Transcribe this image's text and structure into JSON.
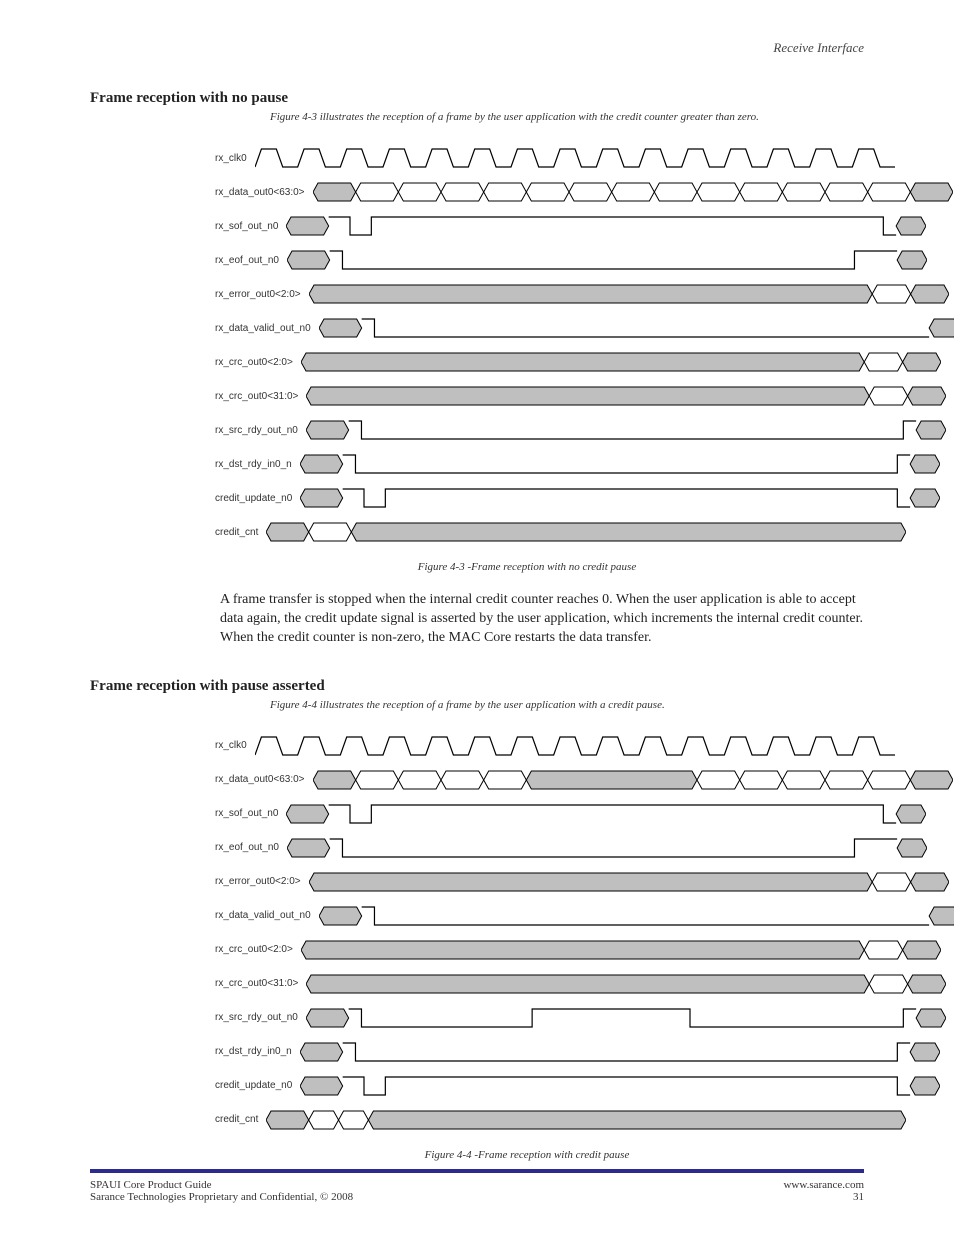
{
  "runhead": "Receive Interface",
  "section1_title": "Frame reception with no pause",
  "section2_title": "Frame reception with pause asserted",
  "signals": [
    "rx_clk0",
    "rx_data_out0<63:0>",
    "rx_sof_out_n0",
    "rx_eof_out_n0",
    "rx_error_out0<2:0>",
    "rx_data_valid_out_n0",
    "rx_crc_out0<2:0>",
    "rx_crc_out0<31:0>",
    "rx_src_rdy_out_n0",
    "rx_dst_rdy_in0_n",
    "credit_update_n0",
    "credit_cnt"
  ],
  "paragraph": "A frame transfer is stopped when the internal credit counter reaches 0. When the user application is able to accept data again, the credit update signal is asserted by the user application, which increments the internal credit counter. When the credit counter is non-zero, the MAC Core restarts the data transfer.",
  "fig1_caption": "Figure 4-3 illustrates the reception of a frame by the user application with the credit counter greater than zero.",
  "fig1_label": "Figure 4-3 -Frame reception with no credit pause",
  "fig2_caption": "Figure 4-4 illustrates the reception of a frame by the user application with a credit pause.",
  "fig2_label": "Figure 4-4 -Frame reception with credit pause",
  "footer_left_line1": "SPAUI Core Product Guide",
  "footer_left_line2": "Sarance Technologies Proprietary and Confidential, © 2008",
  "footer_right_line1": "www.sarance.com",
  "footer_right_line2": "31",
  "chart_data": [
    {
      "type": "timing",
      "title": "Frame reception with no pause",
      "clock_cycles": 15,
      "signals": {
        "rx_clk0": "clock 15 cycles",
        "rx_data_out0<63:0>": "bus, new value every cycle",
        "rx_sof_out_n0": "high, low pulse at cycle 1, high until cycle 14 then low",
        "rx_eof_out_n0": "high, low from cycle 1 to 13, rising at cycle 13",
        "rx_error_out0<2:0>": "bus, hold then change at cycle 13 and 14",
        "rx_data_valid_out_n0": "high then low from cycle 1, low at end",
        "rx_crc_out0<2:0>": "bus, change at cycle 13 and 14",
        "rx_crc_out0<31:0>": "bus, change at cycle 13 and 14",
        "rx_src_rdy_out_n0": "high, low from cycle 1 to 13, then high",
        "rx_dst_rdy_in0_n": "high, low from cycle 1 to 13, then high",
        "credit_update_n0": "high, low pulse at cycle 1, high, low at end",
        "credit_cnt": "bus, change at cycle 1 then hold"
      }
    },
    {
      "type": "timing",
      "title": "Frame reception with pause asserted",
      "clock_cycles": 15,
      "signals": {
        "rx_clk0": "clock 15 cycles",
        "rx_data_out0<63:0>": "bus changing cycles 1-4, hold cycles 5-8, resume 9-14",
        "rx_sof_out_n0": "high, low pulse at cycle 1, high, low at end",
        "rx_eof_out_n0": "high, low cycle 1 to 13, high at 13",
        "rx_error_out0<2:0>": "bus hold, change at 13 and 14",
        "rx_data_valid_out_n0": "high, low from cycle 1, low at end",
        "rx_crc_out0<2:0>": "bus hold, change at 13 and 14",
        "rx_crc_out0<31:0>": "bus hold, change at 13 and 14",
        "rx_src_rdy_out_n0": "high, low 1-4, high 5-8 (pause), low 9-13, high",
        "rx_dst_rdy_in0_n": "high, low 1-13, high",
        "credit_update_n0": "high, low pulse at 1, high, low at end",
        "credit_cnt": "bus, change at 1, change at 2, hold"
      }
    }
  ]
}
